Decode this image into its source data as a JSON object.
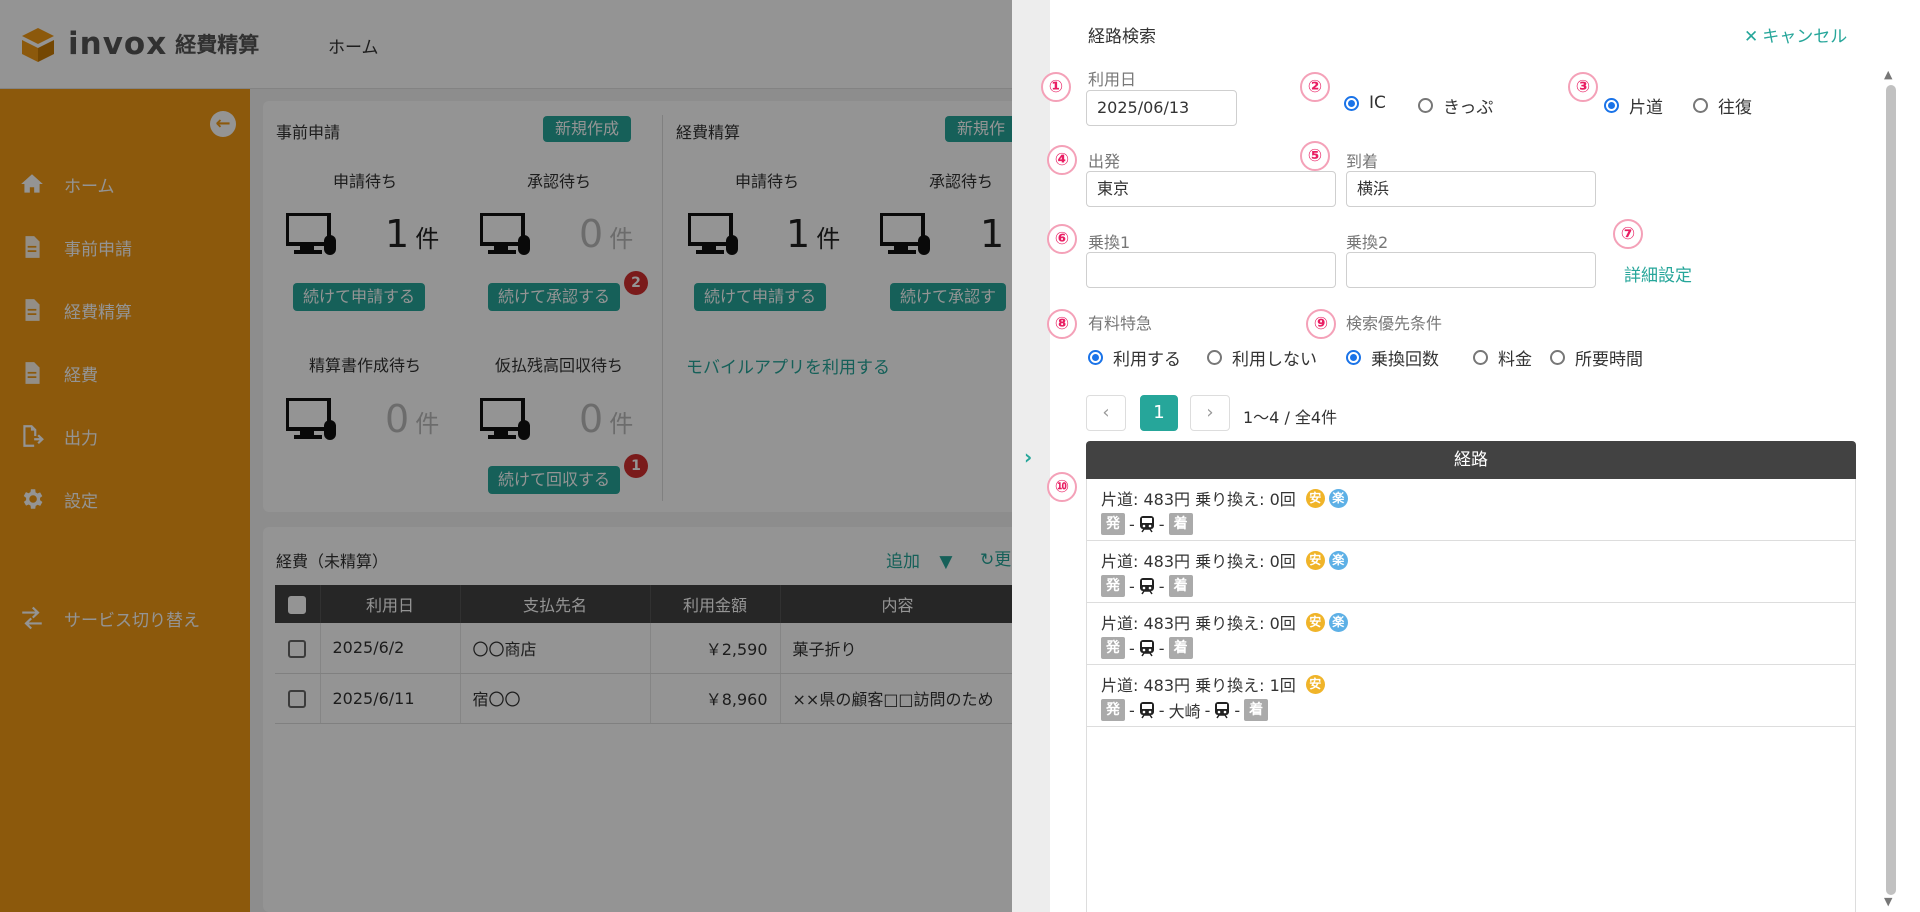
{
  "header": {
    "logo_text": "invox",
    "logo_sub": "経費精算",
    "nav_home": "ホーム"
  },
  "sidebar": {
    "items": [
      {
        "label": "ホーム",
        "icon": "home-icon"
      },
      {
        "label": "事前申請",
        "icon": "document-icon"
      },
      {
        "label": "経費精算",
        "icon": "document-icon"
      },
      {
        "label": "経費",
        "icon": "document-icon"
      },
      {
        "label": "出力",
        "icon": "export-icon"
      },
      {
        "label": "設定",
        "icon": "gear-icon"
      },
      {
        "label": "サービス切り替え",
        "icon": "switch-icon"
      }
    ]
  },
  "pre_application": {
    "title": "事前申請",
    "new_button": "新規作成",
    "pending_apply_label": "申請待ち",
    "pending_apply_count": "1",
    "pending_approve_label": "承認待ち",
    "pending_approve_count": "0",
    "unit": "件",
    "continue_apply": "続けて申請する",
    "continue_approve": "続けて承認する",
    "approve_badge": "2",
    "statement_pending_label": "精算書作成待ち",
    "statement_pending_count": "0",
    "advance_pending_label": "仮払残高回収待ち",
    "advance_pending_count": "0",
    "continue_collect": "続けて回収する",
    "collect_badge": "1"
  },
  "expense_settlement": {
    "title": "経費精算",
    "new_button": "新規作",
    "pending_apply_label": "申請待ち",
    "pending_apply_count": "1",
    "pending_approve_label": "承認待ち",
    "pending_approve_count": "1",
    "continue_apply": "続けて申請する",
    "continue_approve": "続けて承認す",
    "mobile_link": "モバイルアプリを利用する"
  },
  "expenses": {
    "title": "経費（未精算）",
    "add_label": "追加",
    "refresh_label": "更",
    "columns": [
      "利用日",
      "支払先名",
      "利用金額",
      "内容"
    ],
    "rows": [
      {
        "date": "2025/6/2",
        "payee": "〇〇商店",
        "amount": "￥2,590",
        "content": "菓子折り"
      },
      {
        "date": "2025/6/11",
        "payee": "宿〇〇",
        "amount": "￥8,960",
        "content": "××県の顧客□□訪問のため"
      }
    ]
  },
  "drawer": {
    "title": "経路検索",
    "cancel": "キャンセル",
    "markers": [
      "①",
      "②",
      "③",
      "④",
      "⑤",
      "⑥",
      "⑦",
      "⑧",
      "⑨",
      "⑩"
    ],
    "date_label": "利用日",
    "date_value": "2025/06/13",
    "fare_type": {
      "ic": "IC",
      "ticket": "きっぷ",
      "selected": "IC"
    },
    "trip_type": {
      "one_way": "片道",
      "round": "往復",
      "selected": "片道"
    },
    "departure_label": "出発",
    "departure_value": "東京",
    "arrival_label": "到着",
    "arrival_value": "横浜",
    "transfer1_label": "乗換1",
    "transfer1_value": "",
    "transfer2_label": "乗換2",
    "transfer2_value": "",
    "detail_settings": "詳細設定",
    "express_label": "有料特急",
    "express_use": "利用する",
    "express_no": "利用しない",
    "priority_label": "検索優先条件",
    "priority_transfers": "乗換回数",
    "priority_fare": "料金",
    "priority_time": "所要時間",
    "pager": {
      "page": "1",
      "info": "1〜4 / 全4件",
      "prev": "‹",
      "next": "›"
    },
    "routes_header": "経路",
    "routes": [
      {
        "summary": "片道: 483円  乗り換え: 0回",
        "cheap": "安",
        "easy": "楽",
        "start": "発",
        "end": "着",
        "via": ""
      },
      {
        "summary": "片道: 483円  乗り換え: 0回",
        "cheap": "安",
        "easy": "楽",
        "start": "発",
        "end": "着",
        "via": ""
      },
      {
        "summary": "片道: 483円  乗り換え: 0回",
        "cheap": "安",
        "easy": "楽",
        "start": "発",
        "end": "着",
        "via": ""
      },
      {
        "summary": "片道: 483円  乗り換え: 1回",
        "cheap": "安",
        "easy": "",
        "start": "発",
        "end": "着",
        "via": "大崎"
      }
    ]
  },
  "colors": {
    "sidebar": "#f19a15",
    "accent": "#26a69a",
    "marker": "#e91e63",
    "badge": "#d32f2f"
  }
}
